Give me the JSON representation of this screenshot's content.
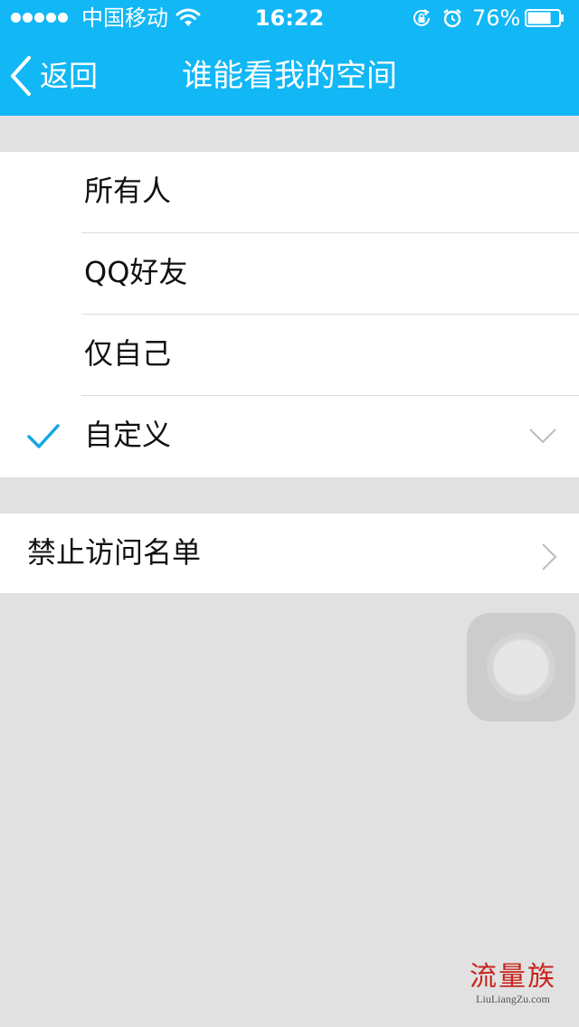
{
  "status_bar": {
    "carrier": "中国移动",
    "time": "16:22",
    "battery_percent": "76%",
    "battery_level": 0.76
  },
  "nav": {
    "back_label": "返回",
    "title": "谁能看我的空间"
  },
  "options": [
    {
      "label": "所有人",
      "selected": false
    },
    {
      "label": "QQ好友",
      "selected": false
    },
    {
      "label": "仅自己",
      "selected": false
    },
    {
      "label": "自定义",
      "selected": true
    }
  ],
  "blocklist": {
    "label": "禁止访问名单"
  },
  "watermark": {
    "text_cn": "流量族",
    "text_en": "LiuLiangZu.com"
  },
  "colors": {
    "accent": "#12b7f5",
    "check": "#12a6e6",
    "background": "#e1e1e1",
    "watermark": "#c8241c"
  },
  "icons": [
    "signal-dots-icon",
    "wifi-icon",
    "rotation-lock-icon",
    "alarm-icon",
    "battery-icon",
    "back-chevron-icon",
    "checkmark-icon",
    "chevron-down-icon",
    "chevron-right-icon"
  ]
}
